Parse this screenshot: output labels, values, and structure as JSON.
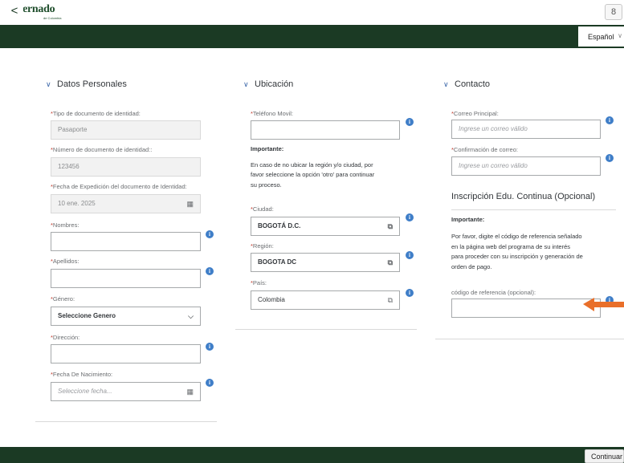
{
  "brand": {
    "logo_text": "Externado",
    "logo_sub": "de Colombia"
  },
  "header": {
    "user_icon": "person-icon",
    "user_glyph": "8"
  },
  "nav": {
    "back_glyph": "<",
    "title": "Datos Personales",
    "language": "Español",
    "language_chevron": "∨"
  },
  "sections": {
    "personal": {
      "title": "Datos Personales",
      "doc_type": {
        "label": "Tipo de documento de identidad:",
        "value": "Pasaporte"
      },
      "doc_number": {
        "label": "Número de documento de identidad::",
        "value": "123456"
      },
      "expedition_date": {
        "label": "Fecha de Expedición del documento de Identidad:",
        "value": "10 ene. 2025"
      },
      "first_names": {
        "label": "Nombres:",
        "value": ""
      },
      "last_names": {
        "label": "Apellidos:",
        "value": ""
      },
      "gender": {
        "label": "Género:",
        "value": "Seleccione Genero"
      },
      "address": {
        "label": "Dirección:",
        "value": ""
      },
      "birth_date": {
        "label": "Fecha De Nacimiento:",
        "placeholder": "Seleccione fecha..."
      }
    },
    "location": {
      "title": "Ubicación",
      "mobile_phone": {
        "label": "Teléfono Movil:",
        "value": ""
      },
      "important_title": "Importante:",
      "important_lines": [
        "En caso de no ubicar la región y/o ciudad, por",
        "favor seleccione la opción 'otro' para continuar",
        "su proceso."
      ],
      "city": {
        "label": "Ciudad:",
        "value": "BOGOTÁ D.C."
      },
      "region": {
        "label": "Región:",
        "value": "BOGOTA DC"
      },
      "country": {
        "label": "País:",
        "value": "Colombia"
      }
    },
    "contact": {
      "title": "Contacto",
      "main_email": {
        "label": "Correo Principal:",
        "placeholder": "Ingrese un correo válido"
      },
      "email_confirm": {
        "label": "Confirmación de correo:",
        "placeholder": "Ingrese un correo válido"
      },
      "continuing_title": "Inscripción Edu. Continua (Opcional)",
      "important_title": "Importante:",
      "important_lines": [
        "Por favor, digite el código de referencia señalado",
        "en la página web del programa de su interés",
        "para proceder con su inscripción y generación de",
        "orden de pago."
      ],
      "reference_code": {
        "label": "código de referencia (opcional):",
        "value": ""
      }
    }
  },
  "footer": {
    "continue_label": "Continuar"
  },
  "colors": {
    "nav_bg": "#1b3a24",
    "info_icon": "#3f7ec8",
    "required": "#c0392b",
    "annotation_arrow": "#e96f2a"
  },
  "symbols": {
    "required": "*",
    "info": "i",
    "section_chevron": "∨",
    "dropdown_chevron": "⌵",
    "calendar_icon": "▦",
    "value_help_icon": "⧉"
  }
}
